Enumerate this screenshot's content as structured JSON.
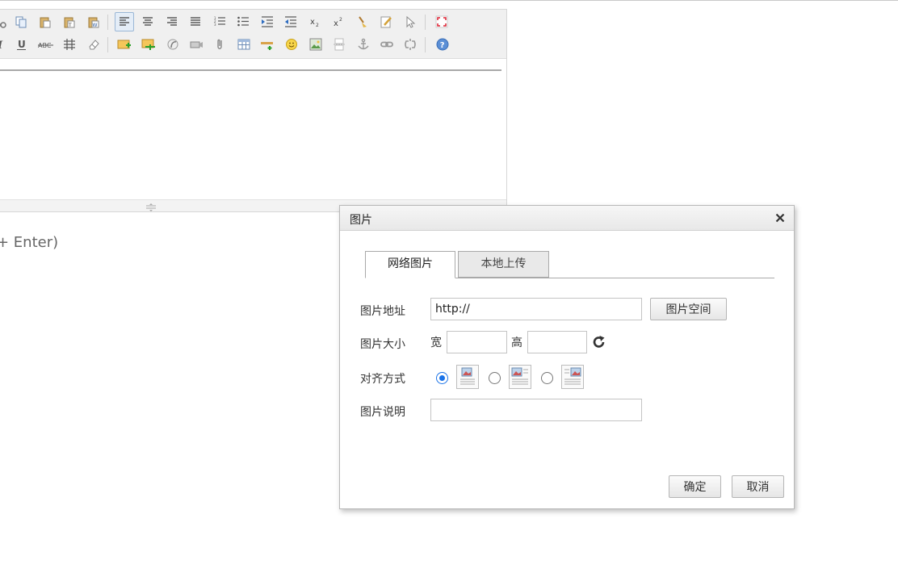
{
  "hint": {
    "text": "+ Enter)"
  },
  "dialog": {
    "title": "图片",
    "close_icon": "×",
    "tabs": [
      {
        "label": "网络图片",
        "active": true
      },
      {
        "label": "本地上传",
        "active": false
      }
    ],
    "url_label": "图片地址",
    "url_value": "http://",
    "space_button": "图片空间",
    "size_label": "图片大小",
    "width_label": "宽",
    "height_label": "高",
    "width_value": "",
    "height_value": "",
    "align_label": "对齐方式",
    "desc_label": "图片说明",
    "desc_value": "",
    "ok_button": "确定",
    "cancel_button": "取消"
  },
  "colors": {
    "accent": "#1a73e8",
    "toolbar_bg": "#f0f0f0",
    "header_bg": "#e8e8e8"
  }
}
